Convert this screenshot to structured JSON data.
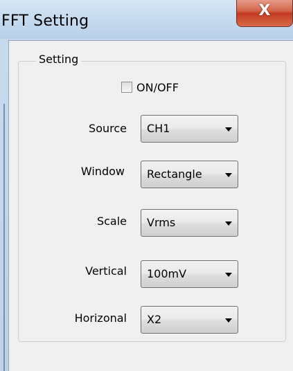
{
  "window": {
    "title": "FFT Setting",
    "close_glyph": "X"
  },
  "group": {
    "title": "Setting"
  },
  "toggle": {
    "label": "ON/OFF",
    "checked": false
  },
  "fields": [
    {
      "label": "Source",
      "value": "CH1"
    },
    {
      "label": "Window",
      "value": "Rectangle"
    },
    {
      "label": "Scale",
      "value": "Vrms"
    },
    {
      "label": "Vertical",
      "value": "100mV"
    },
    {
      "label": "Horizonal",
      "value": "X2"
    }
  ],
  "colors": {
    "titlebar": "#c4d9ee",
    "close_button": "#c43a22",
    "client_background": "#f0f0f0"
  },
  "icons": {
    "close": "close-icon",
    "dropdown": "chevron-down-icon",
    "checkbox": "checkbox-icon"
  }
}
